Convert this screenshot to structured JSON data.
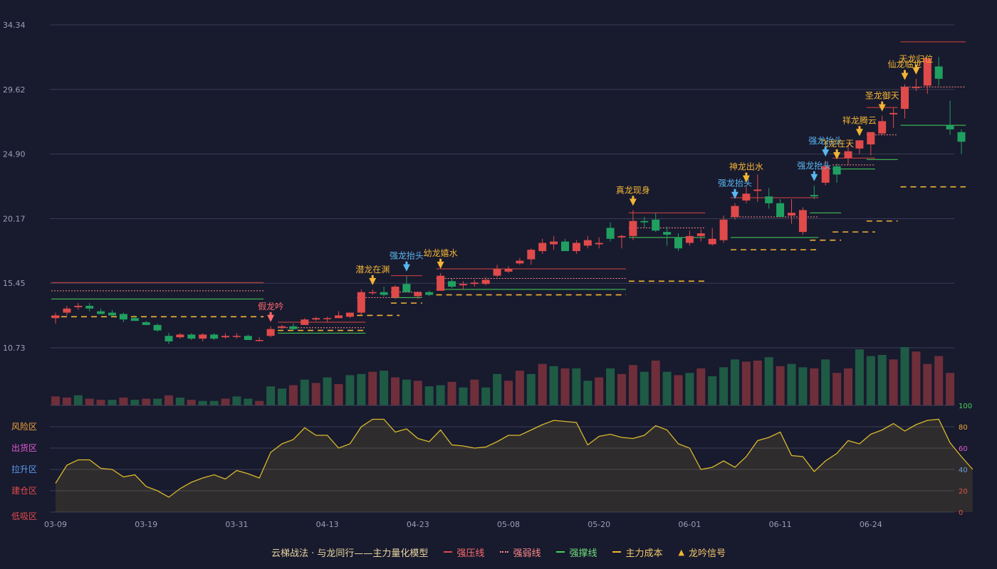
{
  "colors": {
    "up": "#e04a4a",
    "down": "#1fa060",
    "up_vol": "#6e2f3a",
    "down_vol": "#1f5a45",
    "gold": "#f2b534",
    "blue": "#5ab8f0",
    "pink": "#ff6b6b",
    "green_line": "#45d45a",
    "grid": "#3a3d55",
    "text": "#9aa0b4",
    "osc_line": "#d9b92a"
  },
  "chart_data": {
    "type": "candlestick",
    "price_axis": {
      "ticks": [
        "34.34",
        "29.62",
        "24.90",
        "20.17",
        "15.45",
        "10.73"
      ],
      "range": [
        10.73,
        34.34
      ]
    },
    "x_labels": [
      {
        "i": 0,
        "t": "03-09"
      },
      {
        "i": 8,
        "t": "03-19"
      },
      {
        "i": 16,
        "t": "03-31"
      },
      {
        "i": 24,
        "t": "04-13"
      },
      {
        "i": 32,
        "t": "04-23"
      },
      {
        "i": 40,
        "t": "05-08"
      },
      {
        "i": 48,
        "t": "05-20"
      },
      {
        "i": 56,
        "t": "06-01"
      },
      {
        "i": 64,
        "t": "06-11"
      },
      {
        "i": 72,
        "t": "06-24"
      }
    ],
    "ohlc": [
      [
        12.9,
        13.3,
        12.5,
        13.1
      ],
      [
        13.3,
        13.8,
        13.1,
        13.6
      ],
      [
        13.7,
        14.0,
        13.5,
        13.8
      ],
      [
        13.8,
        14.0,
        13.4,
        13.6
      ],
      [
        13.4,
        13.6,
        13.2,
        13.2
      ],
      [
        13.3,
        13.5,
        13.0,
        13.1
      ],
      [
        13.2,
        13.3,
        12.6,
        12.8
      ],
      [
        12.9,
        13.1,
        12.7,
        12.7
      ],
      [
        12.6,
        12.7,
        12.4,
        12.4
      ],
      [
        12.4,
        12.5,
        11.9,
        12.0
      ],
      [
        11.6,
        11.8,
        11.0,
        11.2
      ],
      [
        11.5,
        11.8,
        11.4,
        11.7
      ],
      [
        11.7,
        11.8,
        11.3,
        11.4
      ],
      [
        11.4,
        11.8,
        11.2,
        11.7
      ],
      [
        11.7,
        11.8,
        11.3,
        11.4
      ],
      [
        11.5,
        11.8,
        11.4,
        11.6
      ],
      [
        11.6,
        11.8,
        11.4,
        11.6
      ],
      [
        11.6,
        11.7,
        11.3,
        11.3
      ],
      [
        11.3,
        11.5,
        11.2,
        11.3
      ],
      [
        11.6,
        12.3,
        11.5,
        12.1
      ],
      [
        12.2,
        12.4,
        12.1,
        12.3
      ],
      [
        12.3,
        12.5,
        12.0,
        12.1
      ],
      [
        12.4,
        12.9,
        12.4,
        12.8
      ],
      [
        12.8,
        13.0,
        12.7,
        12.9
      ],
      [
        12.9,
        13.0,
        12.6,
        12.9
      ],
      [
        12.9,
        13.4,
        12.9,
        13.1
      ],
      [
        13.0,
        13.3,
        12.9,
        13.3
      ],
      [
        13.3,
        15.0,
        13.1,
        14.8
      ],
      [
        14.8,
        15.0,
        14.6,
        14.8
      ],
      [
        14.8,
        15.2,
        14.5,
        14.6
      ],
      [
        14.4,
        15.3,
        14.3,
        15.2
      ],
      [
        15.4,
        16.0,
        14.8,
        14.8
      ],
      [
        14.5,
        14.8,
        14.3,
        14.8
      ],
      [
        14.8,
        14.9,
        14.5,
        14.6
      ],
      [
        14.9,
        16.2,
        14.9,
        16.0
      ],
      [
        15.6,
        15.8,
        15.1,
        15.2
      ],
      [
        15.3,
        15.6,
        15.0,
        15.4
      ],
      [
        15.4,
        15.7,
        15.2,
        15.5
      ],
      [
        15.4,
        15.9,
        15.3,
        15.7
      ],
      [
        16.0,
        16.8,
        15.9,
        16.5
      ],
      [
        16.3,
        16.7,
        16.2,
        16.5
      ],
      [
        16.9,
        17.3,
        16.8,
        17.1
      ],
      [
        17.2,
        18.0,
        16.8,
        17.9
      ],
      [
        17.8,
        18.7,
        17.6,
        18.4
      ],
      [
        18.3,
        18.9,
        17.9,
        18.5
      ],
      [
        18.5,
        18.7,
        17.8,
        17.8
      ],
      [
        17.8,
        18.6,
        17.6,
        18.4
      ],
      [
        18.2,
        18.9,
        18.0,
        18.6
      ],
      [
        18.3,
        18.8,
        18.0,
        18.4
      ],
      [
        19.5,
        19.9,
        18.5,
        18.7
      ],
      [
        18.8,
        19.0,
        18.0,
        18.9
      ],
      [
        18.9,
        20.8,
        18.6,
        20.0
      ],
      [
        20.0,
        20.3,
        19.5,
        19.9
      ],
      [
        20.1,
        20.6,
        19.2,
        19.3
      ],
      [
        19.2,
        19.6,
        18.2,
        19.0
      ],
      [
        18.8,
        19.1,
        17.8,
        18.0
      ],
      [
        18.4,
        19.3,
        18.2,
        18.9
      ],
      [
        18.9,
        19.4,
        18.5,
        19.1
      ],
      [
        18.3,
        19.5,
        18.2,
        18.7
      ],
      [
        18.6,
        20.4,
        18.4,
        20.1
      ],
      [
        20.3,
        21.3,
        20.1,
        21.1
      ],
      [
        21.5,
        22.5,
        21.3,
        22.0
      ],
      [
        22.2,
        23.4,
        21.4,
        22.3
      ],
      [
        21.8,
        22.4,
        20.9,
        21.3
      ],
      [
        21.3,
        21.6,
        20.4,
        20.3
      ],
      [
        20.4,
        21.6,
        19.8,
        20.6
      ],
      [
        19.2,
        21.0,
        19.0,
        20.8
      ],
      [
        21.9,
        22.6,
        21.6,
        21.8
      ],
      [
        22.8,
        24.4,
        22.6,
        24.0
      ],
      [
        24.0,
        24.2,
        22.8,
        23.4
      ],
      [
        24.6,
        25.6,
        24.1,
        25.1
      ],
      [
        25.3,
        25.9,
        24.9,
        25.9
      ],
      [
        25.6,
        26.4,
        24.8,
        26.5
      ],
      [
        26.4,
        27.7,
        26.3,
        27.3
      ],
      [
        27.8,
        28.3,
        26.8,
        27.9
      ],
      [
        28.2,
        30.0,
        27.5,
        29.8
      ],
      [
        29.8,
        30.4,
        29.5,
        29.8
      ],
      [
        29.9,
        30.4,
        29.3,
        31.9
      ],
      [
        31.3,
        32.0,
        29.9,
        30.4
      ],
      [
        27.0,
        28.8,
        26.3,
        26.7
      ],
      [
        26.5,
        26.7,
        24.9,
        25.8
      ]
    ],
    "volume": [
      8,
      7,
      9,
      6,
      5,
      5,
      7,
      5,
      6,
      6,
      9,
      7,
      5,
      4,
      4,
      6,
      8,
      6,
      4,
      17,
      15,
      18,
      23,
      20,
      25,
      19,
      27,
      28,
      30,
      31,
      25,
      23,
      22,
      17,
      18,
      21,
      16,
      23,
      16,
      28,
      22,
      31,
      28,
      37,
      35,
      33,
      33,
      22,
      25,
      33,
      28,
      36,
      30,
      40,
      30,
      27,
      29,
      33,
      26,
      34,
      41,
      39,
      40,
      43,
      35,
      37,
      34,
      33,
      41,
      29,
      33,
      50,
      44,
      45,
      41,
      52,
      48,
      37,
      44,
      29
    ],
    "volume_up": [
      1,
      1,
      0,
      1,
      1,
      0,
      1,
      0,
      1,
      0,
      1,
      0,
      1,
      0,
      0,
      1,
      0,
      0,
      1,
      0,
      0,
      1,
      0,
      1,
      0,
      1,
      0,
      0,
      1,
      0,
      1,
      0,
      1,
      0,
      0,
      1,
      0,
      1,
      0,
      0,
      1,
      1,
      0,
      1,
      0,
      1,
      0,
      0,
      1,
      0,
      1,
      1,
      0,
      1,
      0,
      1,
      0,
      1,
      0,
      0,
      0,
      1,
      1,
      0,
      1,
      0,
      0,
      1,
      0,
      1,
      1,
      0,
      0,
      0,
      1,
      0,
      1,
      1,
      1,
      1
    ],
    "oscillator": {
      "levels": [
        {
          "t": "风险区",
          "c": "#f2a53a",
          "v": 80
        },
        {
          "t": "出货区",
          "c": "#e05ad0",
          "v": 60
        },
        {
          "t": "拉升区",
          "c": "#5a9ef0",
          "v": 40
        },
        {
          "t": "建仓区",
          "c": "#e04a4a",
          "v": 20
        },
        {
          "t": "低吸区",
          "c": "#e04a4a",
          "v": 0
        }
      ],
      "right_ticks": [
        {
          "v": 100,
          "c": "#45d45a"
        },
        {
          "v": 80,
          "c": "#f2a53a"
        },
        {
          "v": 60,
          "c": "#e05ad0"
        },
        {
          "v": 40,
          "c": "#5a9ef0"
        },
        {
          "v": 20,
          "c": "#e04a4a"
        },
        {
          "v": 0,
          "c": "#e04a4a"
        }
      ],
      "values": [
        27,
        44,
        49,
        49,
        41,
        40,
        33,
        35,
        24,
        20,
        14,
        22,
        28,
        32,
        35,
        31,
        39,
        36,
        32,
        56,
        64,
        68,
        79,
        72,
        72,
        60,
        64,
        80,
        87,
        87,
        75,
        78,
        69,
        66,
        77,
        63,
        62,
        60,
        61,
        66,
        72,
        72,
        77,
        82,
        86,
        85,
        84,
        63,
        71,
        73,
        70,
        69,
        72,
        81,
        77,
        64,
        60,
        40,
        42,
        48,
        42,
        52,
        67,
        70,
        75,
        53,
        52,
        38,
        48,
        55,
        67,
        64,
        73,
        77,
        83,
        76,
        82,
        86,
        87,
        65,
        52,
        40
      ]
    },
    "signals": [
      {
        "i": 19,
        "t": "假龙吟",
        "c": "#ff6b6b"
      },
      {
        "i": 28,
        "t": "潜龙在渊",
        "c": "#f2b534"
      },
      {
        "i": 31,
        "t": "强龙抬头",
        "c": "#5ab8f0"
      },
      {
        "i": 34,
        "t": "幼龙嬉水",
        "c": "#f2b534"
      },
      {
        "i": 51,
        "t": "真龙现身",
        "c": "#f2b534"
      },
      {
        "i": 60,
        "t": "强龙抬头",
        "c": "#5ab8f0"
      },
      {
        "i": 61,
        "t": "神龙出水",
        "c": "#f2b534"
      },
      {
        "i": 67,
        "t": "强龙抬头",
        "c": "#5ab8f0"
      },
      {
        "i": 68,
        "t": "强龙抬头",
        "c": "#5ab8f0"
      },
      {
        "i": 69,
        "t": "飞龙在天",
        "c": "#f2b534"
      },
      {
        "i": 71,
        "t": "祥龙腾云",
        "c": "#f2b534"
      },
      {
        "i": 73,
        "t": "圣龙御天",
        "c": "#f2b534"
      },
      {
        "i": 75,
        "t": "仙龙临世",
        "c": "#f2b534"
      },
      {
        "i": 76,
        "t": "天龙归位",
        "c": "#f2b534"
      }
    ],
    "levels": [
      {
        "from": 0,
        "to": 18,
        "press": 15.5,
        "weak": 14.9,
        "support": 14.3,
        "cost": 13.0
      },
      {
        "from": 20,
        "to": 27,
        "press": 12.6,
        "weak": 12.2,
        "support": 11.8,
        "cost": 12.0
      },
      {
        "from": 27,
        "to": 30,
        "press": null,
        "weak": 14.4,
        "support": null,
        "cost": 13.1
      },
      {
        "from": 30,
        "to": 32,
        "press": 16.0,
        "weak": 14.8,
        "support": 14.4,
        "cost": 14.0
      },
      {
        "from": 34,
        "to": 50,
        "press": 16.5,
        "weak": 15.8,
        "support": 15.0,
        "cost": 14.6
      },
      {
        "from": 51,
        "to": 57,
        "press": 20.6,
        "weak": 19.5,
        "support": 18.8,
        "cost": 15.6
      },
      {
        "from": 60,
        "to": 67,
        "press": 21.7,
        "weak": 20.3,
        "support": 18.8,
        "cost": 17.9
      },
      {
        "from": 67,
        "to": 69,
        "press": null,
        "weak": null,
        "support": 20.6,
        "cost": 18.6
      },
      {
        "from": 69,
        "to": 72,
        "press": 24.6,
        "weak": 24.1,
        "support": 23.8,
        "cost": 19.2
      },
      {
        "from": 72,
        "to": 74,
        "press": 28.3,
        "weak": 26.3,
        "support": 24.5,
        "cost": 20.0
      },
      {
        "from": 75,
        "to": 80,
        "press": 33.1,
        "weak": 29.8,
        "support": 27.0,
        "cost": 22.5
      }
    ]
  },
  "legend": {
    "title": "云梯战法 · 与龙同行——主力量化模型",
    "items": [
      {
        "label": "强压线",
        "c": "#e04a4a",
        "style": "solid"
      },
      {
        "label": "强弱线",
        "c": "#ff8a8a",
        "style": "dotted"
      },
      {
        "label": "强撑线",
        "c": "#45d45a",
        "style": "solid"
      },
      {
        "label": "主力成本",
        "c": "#f2b534",
        "style": "dashed"
      },
      {
        "label": "龙吟信号",
        "c": "#f2b534",
        "style": "tri",
        "glyph": "▲"
      }
    ]
  }
}
